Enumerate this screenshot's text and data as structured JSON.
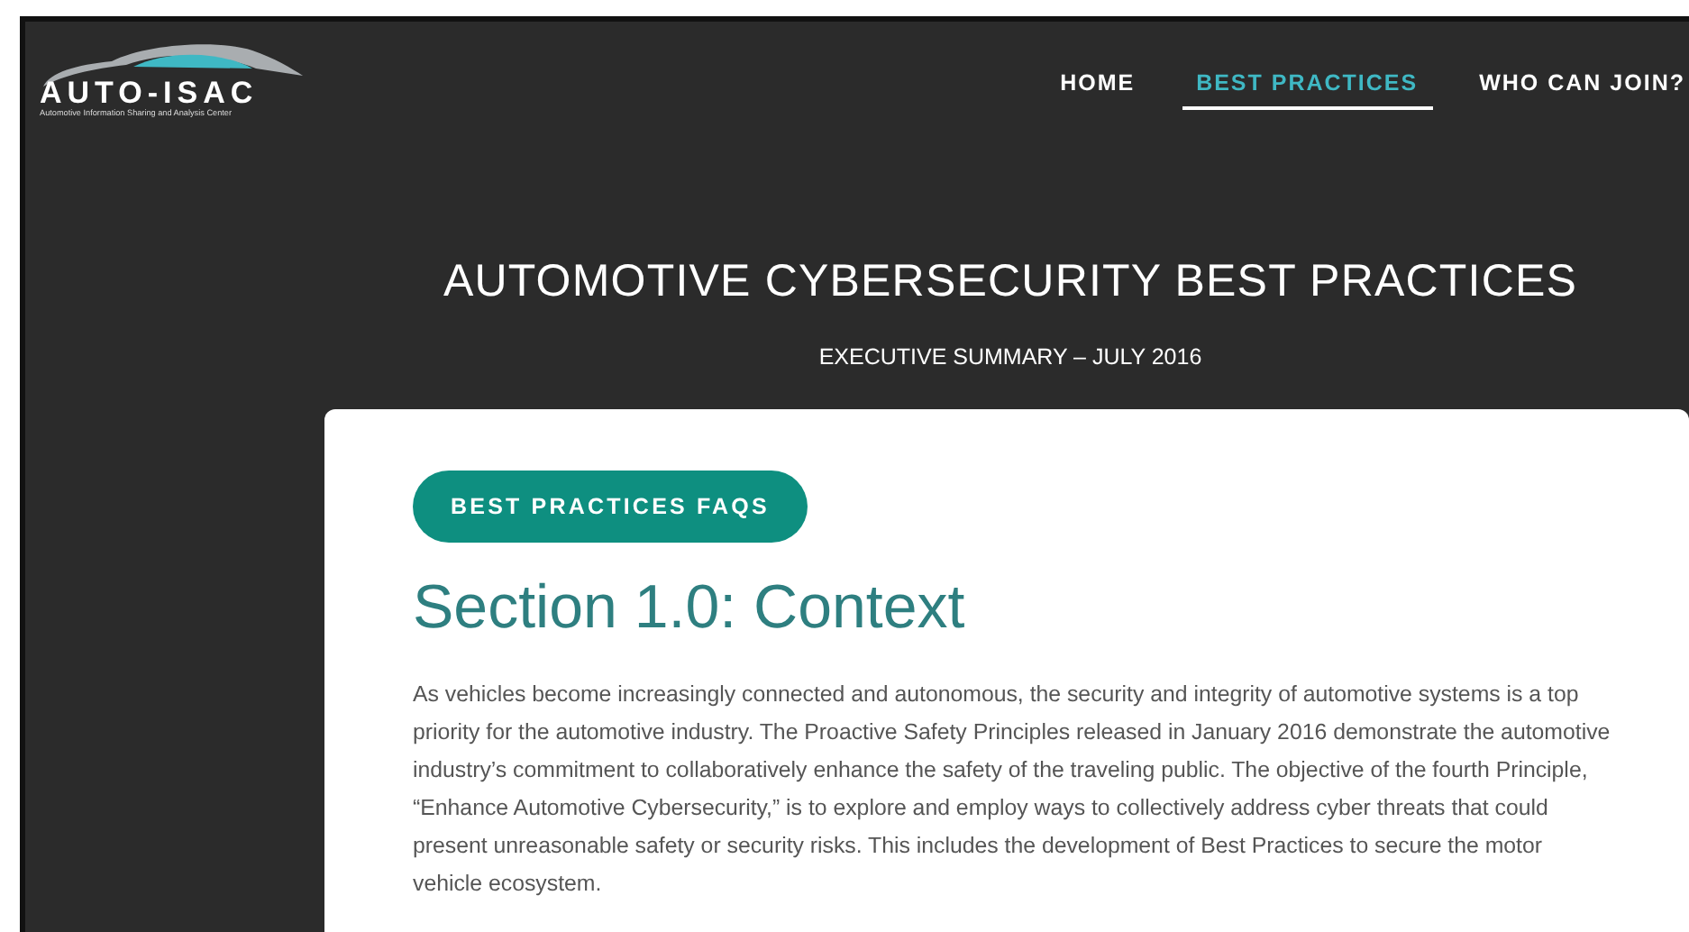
{
  "logo": {
    "name": "AUTO-ISAC",
    "tagline": "Automotive Information Sharing and Analysis Center"
  },
  "nav": [
    {
      "label": "HOME",
      "selected": false
    },
    {
      "label": "BEST PRACTICES",
      "selected": true
    },
    {
      "label": "WHO CAN JOIN?",
      "selected": false
    }
  ],
  "hero": {
    "title": "AUTOMOTIVE CYBERSECURITY BEST PRACTICES",
    "subtitle": "EXECUTIVE SUMMARY – JULY 2016"
  },
  "content": {
    "button": "BEST PRACTICES FAQS",
    "heading": "Section 1.0: Context",
    "paragraph": "As vehicles become increasingly connected and autonomous, the security and integrity of automotive systems is a top priority for the automotive industry. The Proactive Safety Principles released in January 2016 demonstrate the automotive industry’s commitment to collaboratively enhance the safety of the traveling public. The objective of the fourth Principle, “Enhance Automotive Cybersecurity,” is to explore and employ ways to collectively address cyber threats that could present unreasonable safety or security risks. This includes the development of Best Practices to secure the motor vehicle ecosystem."
  }
}
